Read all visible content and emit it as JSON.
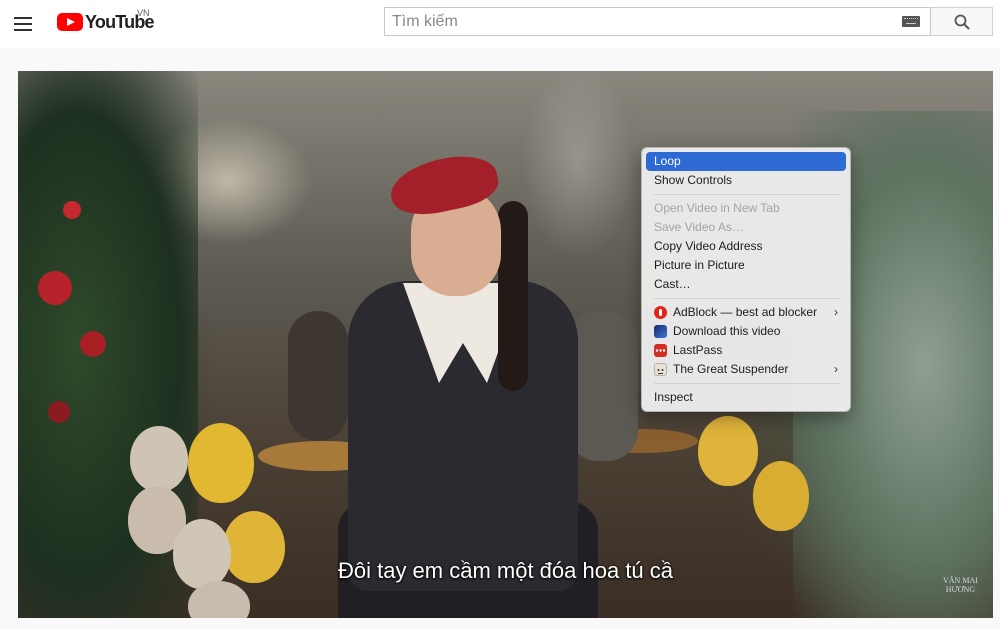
{
  "header": {
    "logo_text": "YouTube",
    "logo_country": "VN",
    "search_placeholder": "Tìm kiếm",
    "icons": [
      "menu-icon",
      "youtube-logo",
      "keyboard-icon",
      "search-icon"
    ]
  },
  "video": {
    "subtitle": "Đôi tay em cầm một đóa hoa tú cầ",
    "watermark_line1": "VĂN MAI",
    "watermark_line2": "HƯƠNG"
  },
  "context_menu": {
    "items": [
      {
        "label": "Loop",
        "state": "highlighted"
      },
      {
        "label": "Show Controls",
        "state": "normal"
      },
      {
        "label": "Open Video in New Tab",
        "state": "disabled"
      },
      {
        "label": "Save Video As…",
        "state": "disabled"
      },
      {
        "label": "Copy Video Address",
        "state": "normal"
      },
      {
        "label": "Picture in Picture",
        "state": "normal"
      },
      {
        "label": "Cast…",
        "state": "normal"
      },
      {
        "label": "AdBlock — best ad blocker",
        "state": "normal",
        "icon": "adblock-icon",
        "submenu": true
      },
      {
        "label": "Download this video",
        "state": "normal",
        "icon": "download-video-icon"
      },
      {
        "label": "LastPass",
        "state": "normal",
        "icon": "lastpass-icon"
      },
      {
        "label": "The Great Suspender",
        "state": "normal",
        "icon": "great-suspender-icon",
        "submenu": true
      },
      {
        "label": "Inspect",
        "state": "normal"
      }
    ],
    "highlight_color": "#2d6ad4"
  },
  "colors": {
    "brand_red": "#ff0000",
    "adblock": "#e3241b",
    "lastpass": "#d32d27"
  }
}
